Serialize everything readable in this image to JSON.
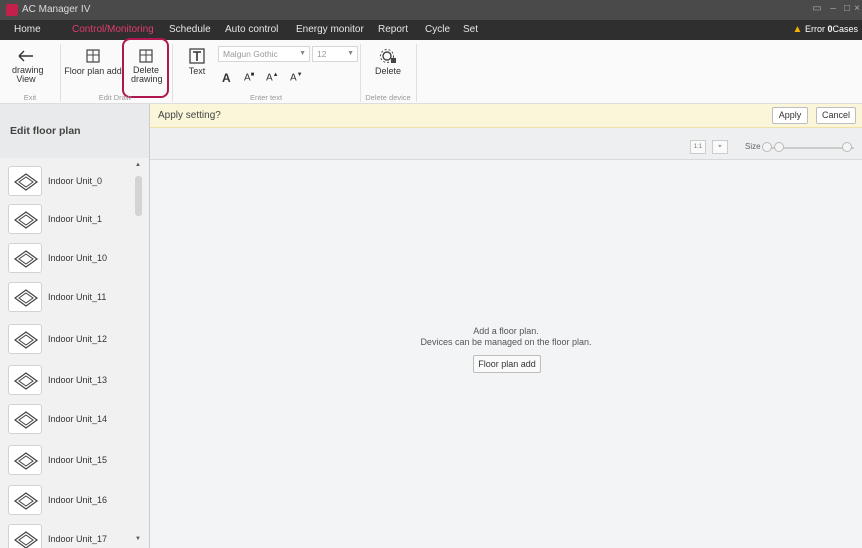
{
  "window": {
    "title": "AC Manager IV"
  },
  "menu": {
    "items": [
      "Home",
      "Control/Monitoring",
      "Schedule",
      "Auto control",
      "Energy monitor",
      "Report",
      "Cycle",
      "Set"
    ],
    "active_index": 1,
    "error_label": "Error",
    "error_count": "0",
    "error_suffix": "Cases"
  },
  "ribbon": {
    "drawing_view": "drawing View",
    "floor_plan_add": "Floor plan add",
    "delete_drawing": "Delete drawing",
    "text": "Text",
    "font_name": "Malgun Gothic",
    "font_size": "12",
    "delete_device": "Delete",
    "groups": {
      "exit": "Exit",
      "edit_draw": "Edit Draw",
      "enter_text": "Enter text",
      "delete_device": "Delete device"
    }
  },
  "left_panel": {
    "header": "Edit floor plan",
    "devices": [
      "Indoor Unit_0",
      "Indoor Unit_1",
      "Indoor Unit_10",
      "Indoor Unit_11",
      "Indoor Unit_12",
      "Indoor Unit_13",
      "Indoor Unit_14",
      "Indoor Unit_15",
      "Indoor Unit_16",
      "Indoor Unit_17"
    ]
  },
  "apply_bar": {
    "message": "Apply setting?",
    "apply": "Apply",
    "cancel": "Cancel"
  },
  "toolbar": {
    "actual_size": "1:1",
    "size_label": "Size"
  },
  "canvas": {
    "line1": "Add a floor plan.",
    "line2": "Devices can be managed on the floor plan.",
    "button": "Floor plan add"
  },
  "colors": {
    "accent": "#e23c6f",
    "highlight": "#b0164f",
    "menubar": "#2f2f2f",
    "apply_bar": "#fbf6d9"
  }
}
